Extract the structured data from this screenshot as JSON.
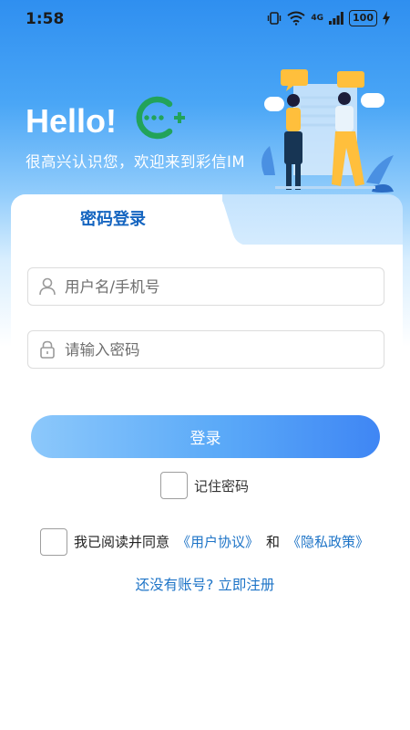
{
  "status_bar": {
    "time": "1:58",
    "network_label": "4G",
    "battery_level": "100"
  },
  "header": {
    "greeting": "Hello!",
    "welcome_text": "很高兴认识您，欢迎来到彩信IM"
  },
  "login_tabs": {
    "active_tab_label": "密码登录"
  },
  "form": {
    "username_placeholder": "用户名/手机号",
    "username_value": "",
    "password_placeholder": "请输入密码",
    "password_value": "",
    "login_button_label": "登录",
    "remember_label": "记住密码",
    "remember_checked": false
  },
  "agreement": {
    "prefix_text": "我已阅读并同意",
    "user_agreement_link": "《用户协议》",
    "conjunction": "和",
    "privacy_policy_link": "《隐私政策》",
    "checked": false
  },
  "register_link": "还没有账号? 立即注册",
  "colors": {
    "primary": "#1565c0",
    "link": "#1e74c7",
    "button_gradient_start": "#8cc8fb",
    "button_gradient_end": "#3f86f4",
    "logo_green": "#22a35a"
  }
}
